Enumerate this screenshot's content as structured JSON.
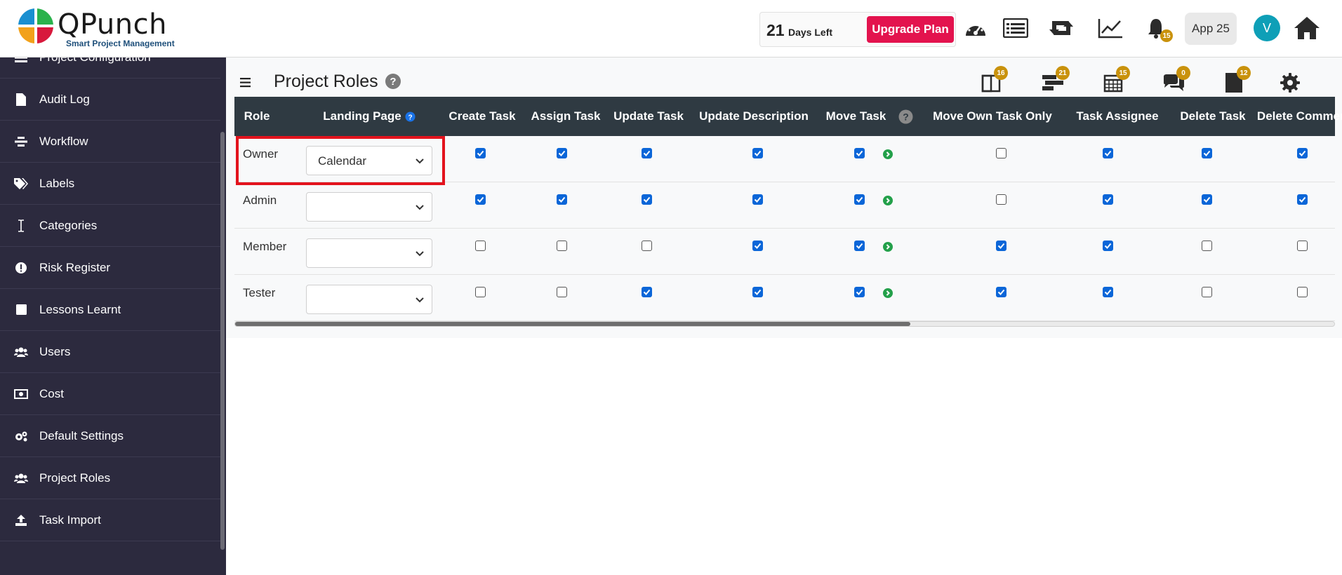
{
  "brand": {
    "name": "QPunch",
    "tagline": "Smart Project Management"
  },
  "header": {
    "days_number": "21",
    "days_label": "Days Left",
    "upgrade_label": "Upgrade Plan",
    "notifications_count": "15",
    "app_label": "App 25",
    "avatar_initial": "V"
  },
  "sidebar": {
    "items": [
      {
        "label": "Project Configuration",
        "icon": "config-icon"
      },
      {
        "label": "Audit Log",
        "icon": "file-icon"
      },
      {
        "label": "Workflow",
        "icon": "workflow-icon"
      },
      {
        "label": "Labels",
        "icon": "tags-icon"
      },
      {
        "label": "Categories",
        "icon": "text-cursor-icon"
      },
      {
        "label": "Risk Register",
        "icon": "exclamation-icon"
      },
      {
        "label": "Lessons Learnt",
        "icon": "square-icon"
      },
      {
        "label": "Users",
        "icon": "users-icon"
      },
      {
        "label": "Cost",
        "icon": "money-icon"
      },
      {
        "label": "Default Settings",
        "icon": "gears-icon"
      },
      {
        "label": "Project Roles",
        "icon": "users-icon"
      },
      {
        "label": "Task Import",
        "icon": "upload-icon"
      }
    ]
  },
  "page": {
    "title": "Project Roles"
  },
  "toolbar": {
    "badges": [
      "16",
      "21",
      "15",
      "0",
      "12"
    ]
  },
  "table": {
    "headers": [
      "Role",
      "Landing Page",
      "Create Task",
      "Assign Task",
      "Update Task",
      "Update Description",
      "Move Task",
      "Move Own Task Only",
      "Task Assignee",
      "Delete Task",
      "Delete Comment"
    ],
    "rows": [
      {
        "role": "Owner",
        "landing": "Calendar",
        "perms": [
          true,
          true,
          true,
          true,
          true,
          false,
          true,
          true,
          true
        ]
      },
      {
        "role": "Admin",
        "landing": "",
        "perms": [
          true,
          true,
          true,
          true,
          true,
          false,
          true,
          true,
          true
        ]
      },
      {
        "role": "Member",
        "landing": "",
        "perms": [
          false,
          false,
          false,
          true,
          true,
          true,
          true,
          false,
          false
        ]
      },
      {
        "role": "Tester",
        "landing": "",
        "perms": [
          false,
          false,
          true,
          true,
          true,
          true,
          true,
          false,
          false
        ]
      }
    ]
  },
  "colors": {
    "sidebar_bg": "#2c2a3e",
    "table_header_bg": "#2f3a42",
    "accent_red": "#e3134e",
    "badge_gold": "#c9920c",
    "checkbox_blue": "#0b66d8"
  }
}
